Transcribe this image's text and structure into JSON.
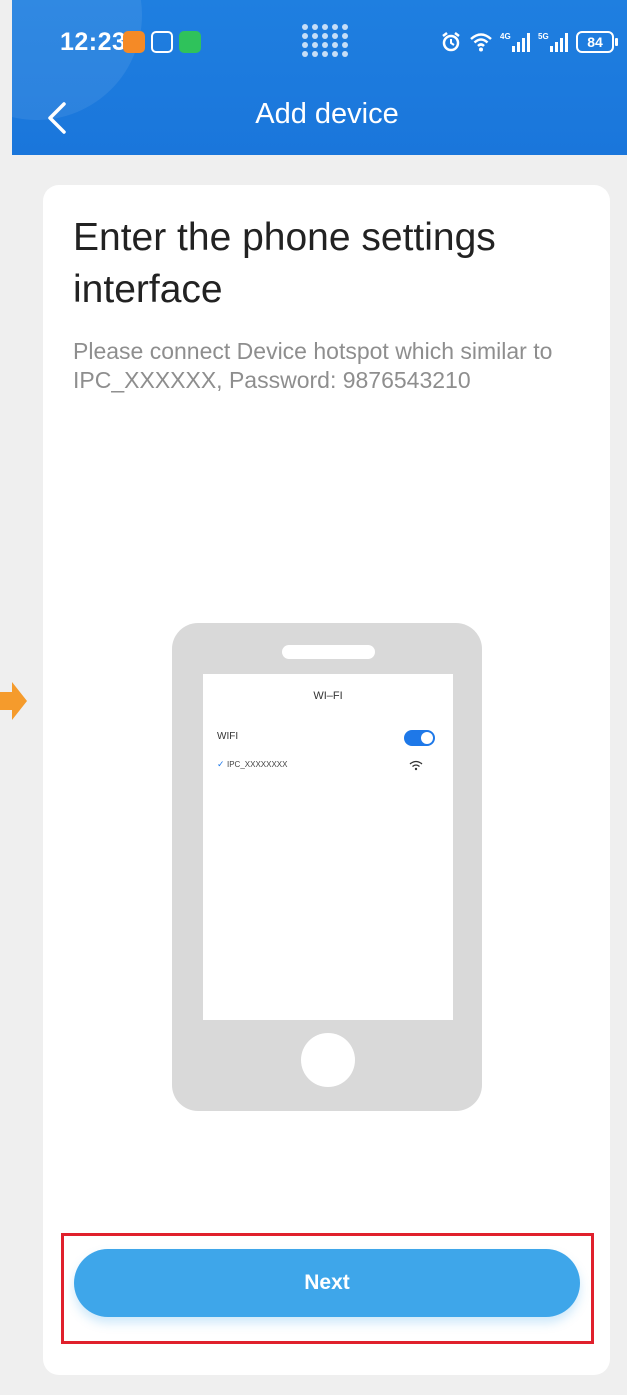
{
  "status_bar": {
    "time": "12:23",
    "battery": "84",
    "network_labels": [
      "4G",
      "5G"
    ]
  },
  "header": {
    "title": "Add device"
  },
  "content": {
    "heading": "Enter the phone settings interface",
    "description": "Please connect Device hotspot which similar to IPC_XXXXXX, Password: 9876543210"
  },
  "illustration": {
    "screen_title": "WI–FI",
    "wifi_label": "WIFI",
    "wifi_on": true,
    "network_name": "IPC_XXXXXXXX"
  },
  "actions": {
    "next_label": "Next"
  },
  "colors": {
    "header_bg": "#1a76db",
    "button_bg": "#3ea6ea",
    "highlight_border": "#e0202c",
    "toggle_on": "#1e78e8",
    "side_arrow": "#f59b2c"
  },
  "icons": [
    "back-chevron-icon",
    "alarm-icon",
    "wifi-icon",
    "signal-icon",
    "battery-icon",
    "check-icon",
    "arrow-right-icon"
  ]
}
